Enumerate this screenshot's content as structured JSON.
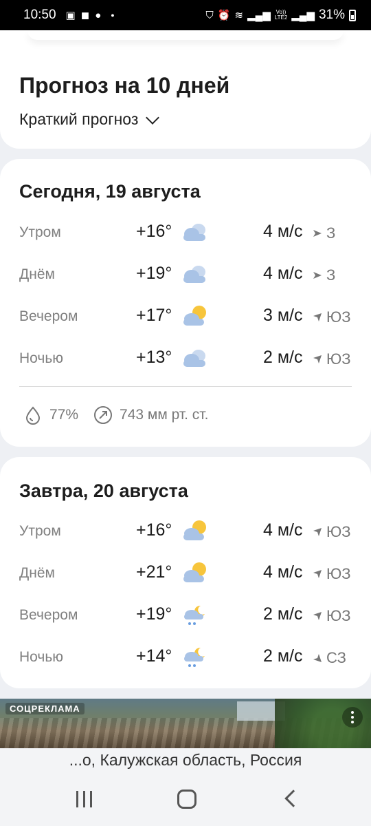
{
  "status_bar": {
    "time": "10:50",
    "network_top": "Vo))",
    "network_bottom": "LTE2",
    "battery": "31%"
  },
  "forecast": {
    "title": "Прогноз на 10 дней",
    "mode_label": "Краткий прогноз"
  },
  "days": [
    {
      "title": "Сегодня, 19 августа",
      "rows": [
        {
          "period": "Утром",
          "temp": "+16°",
          "icon": "cloudy-icon",
          "wind": "4 м/с",
          "dir": "З",
          "dir_arrow": "east-arrow-icon"
        },
        {
          "period": "Днём",
          "temp": "+19°",
          "icon": "cloudy-icon",
          "wind": "4 м/с",
          "dir": "З",
          "dir_arrow": "east-arrow-icon"
        },
        {
          "period": "Вечером",
          "temp": "+17°",
          "icon": "partly-cloudy-icon",
          "wind": "3 м/с",
          "dir": "ЮЗ",
          "dir_arrow": "northeast-arrow-icon"
        },
        {
          "period": "Ночью",
          "temp": "+13°",
          "icon": "cloudy-icon",
          "wind": "2 м/с",
          "dir": "ЮЗ",
          "dir_arrow": "northeast-arrow-icon"
        }
      ],
      "humidity": "77%",
      "pressure": "743 мм рт. ст."
    },
    {
      "title": "Завтра, 20 августа",
      "rows": [
        {
          "period": "Утром",
          "temp": "+16°",
          "icon": "partly-cloudy-icon",
          "wind": "4 м/с",
          "dir": "ЮЗ",
          "dir_arrow": "northeast-arrow-icon"
        },
        {
          "period": "Днём",
          "temp": "+21°",
          "icon": "partly-cloudy-icon",
          "wind": "4 м/с",
          "dir": "ЮЗ",
          "dir_arrow": "northeast-arrow-icon"
        },
        {
          "period": "Вечером",
          "temp": "+19°",
          "icon": "night-rain-icon",
          "wind": "2 м/с",
          "dir": "ЮЗ",
          "dir_arrow": "northeast-arrow-icon"
        },
        {
          "period": "Ночью",
          "temp": "+14°",
          "icon": "night-rain-icon",
          "wind": "2 м/с",
          "dir": "СЗ",
          "dir_arrow": "southeast-arrow-icon"
        }
      ]
    }
  ],
  "ad": {
    "label": "СОЦРЕКЛАМА"
  },
  "location_text": "...о, Калужская область, Россия",
  "colors": {
    "background": "#eef0f4",
    "card": "#ffffff",
    "cloud": "#a9c3e6",
    "sun": "#f7c53c",
    "rain": "#6a9ee0"
  }
}
